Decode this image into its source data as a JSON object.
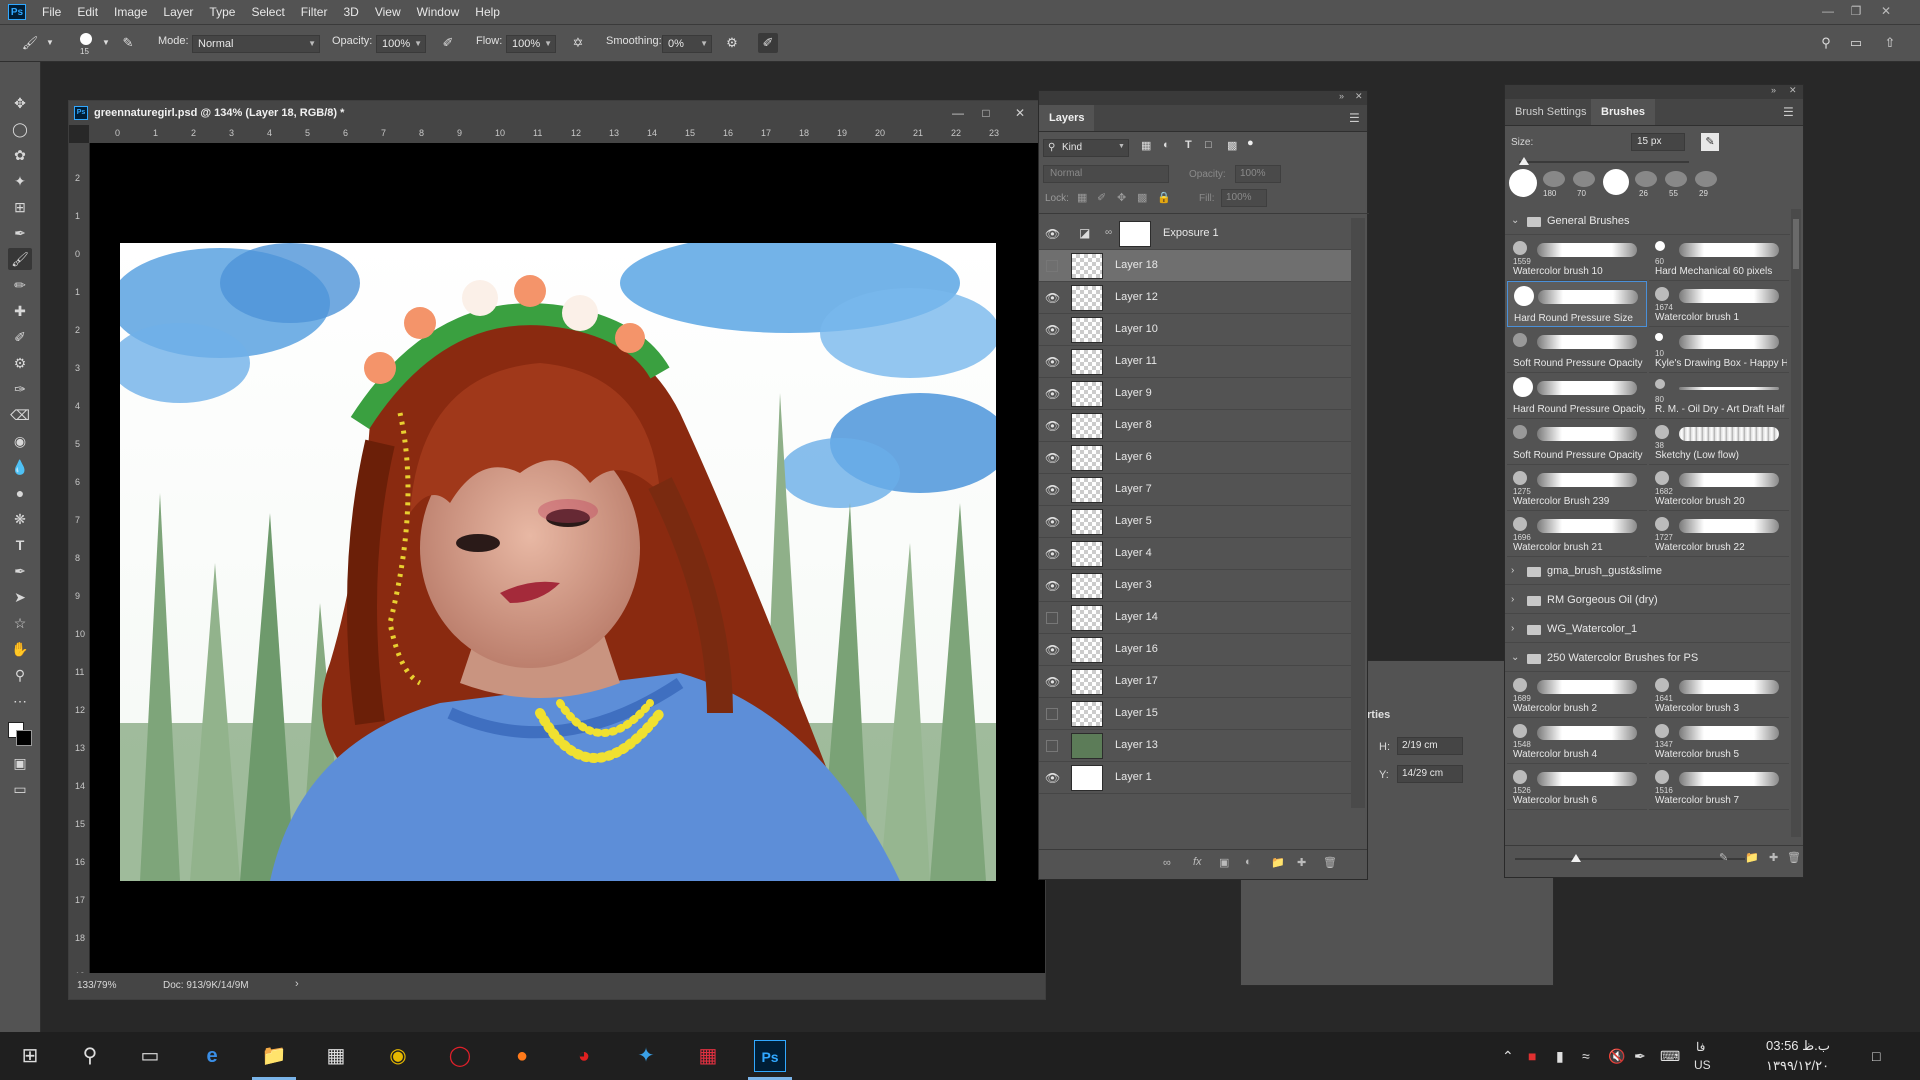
{
  "app": {
    "logo": "Ps"
  },
  "menubar": {
    "items": [
      "File",
      "Edit",
      "Image",
      "Layer",
      "Type",
      "Select",
      "Filter",
      "3D",
      "View",
      "Window",
      "Help"
    ]
  },
  "options": {
    "brush_size": "15",
    "mode_label": "Mode:",
    "mode_value": "Normal",
    "opacity_label": "Opacity:",
    "opacity_value": "100%",
    "flow_label": "Flow:",
    "flow_value": "100%",
    "smoothing_label": "Smoothing:",
    "smoothing_value": "0%"
  },
  "document": {
    "title": "greennaturegirl.psd @ 134% (Layer 18, RGB/8) *",
    "zoom": "133/79%",
    "doc_size": "Doc: 913/9K/14/9M",
    "hruler": [
      "0",
      "1",
      "2",
      "3",
      "4",
      "5",
      "6",
      "7",
      "8",
      "9",
      "10",
      "11",
      "12",
      "13",
      "14",
      "15",
      "16",
      "17",
      "18",
      "19",
      "20",
      "21",
      "22",
      "23"
    ],
    "vruler": [
      "2",
      "1",
      "0",
      "1",
      "2",
      "3",
      "4",
      "5",
      "6",
      "7",
      "8",
      "9",
      "10",
      "11",
      "12",
      "13",
      "14",
      "15",
      "16",
      "17",
      "18",
      "19"
    ]
  },
  "layers": {
    "tab": "Layers",
    "filter_kind": "Kind",
    "blend": "Normal",
    "opacity_label": "Opacity:",
    "opacity_value": "100%",
    "lock_label": "Lock:",
    "fill_label": "Fill:",
    "fill_value": "100%",
    "rows": [
      {
        "name": "Exposure 1",
        "visible": true,
        "adjust": true
      },
      {
        "name": "Layer 18",
        "visible": false,
        "selected": true
      },
      {
        "name": "Layer 12",
        "visible": true
      },
      {
        "name": "Layer 10",
        "visible": true
      },
      {
        "name": "Layer 11",
        "visible": true
      },
      {
        "name": "Layer 9",
        "visible": true
      },
      {
        "name": "Layer 8",
        "visible": true
      },
      {
        "name": "Layer 6",
        "visible": true
      },
      {
        "name": "Layer 7",
        "visible": true
      },
      {
        "name": "Layer 5",
        "visible": true
      },
      {
        "name": "Layer 4",
        "visible": true
      },
      {
        "name": "Layer 3",
        "visible": true
      },
      {
        "name": "Layer 14",
        "visible": false
      },
      {
        "name": "Layer 16",
        "visible": true
      },
      {
        "name": "Layer 17",
        "visible": true
      },
      {
        "name": "Layer 15",
        "visible": false
      },
      {
        "name": "Layer 13",
        "visible": false,
        "fill": "#5c7c58"
      },
      {
        "name": "Layer 1",
        "visible": true,
        "fill": "#ffffff"
      }
    ]
  },
  "properties": {
    "title": "rties",
    "h_label": "H:",
    "h_value": "2/19 cm",
    "y_label": "Y:",
    "y_value": "14/29 cm"
  },
  "brushes": {
    "tab_settings": "Brush Settings",
    "tab_brushes": "Brushes",
    "size_label": "Size:",
    "size_value": "15 px",
    "recent_sizes": [
      "",
      "180",
      "70",
      "",
      "26",
      "55",
      "29"
    ],
    "groups": [
      {
        "name": "General Brushes",
        "open": true,
        "brushes": [
          {
            "size": "1559",
            "name": "Watercolor brush 10"
          },
          {
            "size": "60",
            "name": "Hard Mechanical 60 pixels"
          },
          {
            "size": "",
            "name": "Hard Round Pressure Size",
            "selected": true
          },
          {
            "size": "1674",
            "name": "Watercolor brush 1"
          },
          {
            "size": "",
            "name": "Soft Round Pressure Opacity"
          },
          {
            "size": "10",
            "name": "Kyle's Drawing Box - Happy HB"
          },
          {
            "size": "",
            "name": "Hard Round Pressure Opacity"
          },
          {
            "size": "80",
            "name": "R. M. - Oil Dry - Art Draft Half Dr..."
          },
          {
            "size": "",
            "name": "Soft Round Pressure Opacity and..."
          },
          {
            "size": "38",
            "name": "Sketchy (Low flow)"
          },
          {
            "size": "1275",
            "name": "Watercolor Brush 239"
          },
          {
            "size": "1682",
            "name": "Watercolor brush 20"
          },
          {
            "size": "1696",
            "name": "Watercolor brush 21"
          },
          {
            "size": "1727",
            "name": "Watercolor brush 22"
          }
        ]
      },
      {
        "name": "gma_brush_gust&slime",
        "open": false,
        "brushes": []
      },
      {
        "name": "RM Gorgeous Oil (dry)",
        "open": false,
        "brushes": []
      },
      {
        "name": "WG_Watercolor_1",
        "open": false,
        "brushes": []
      },
      {
        "name": "250 Watercolor Brushes for PS",
        "open": true,
        "brushes": [
          {
            "size": "1689",
            "name": "Watercolor brush 2"
          },
          {
            "size": "1641",
            "name": "Watercolor brush 3"
          },
          {
            "size": "1548",
            "name": "Watercolor brush 4"
          },
          {
            "size": "1347",
            "name": "Watercolor brush 5"
          },
          {
            "size": "1526",
            "name": "Watercolor brush 6"
          },
          {
            "size": "1516",
            "name": "Watercolor brush 7"
          }
        ]
      }
    ]
  },
  "taskbar": {
    "clock_time": "03:56 ب.ظ",
    "clock_date": "۱۳۹۹/۱۲/۲۰",
    "lang_top": "فا",
    "lang_bottom": "US"
  }
}
